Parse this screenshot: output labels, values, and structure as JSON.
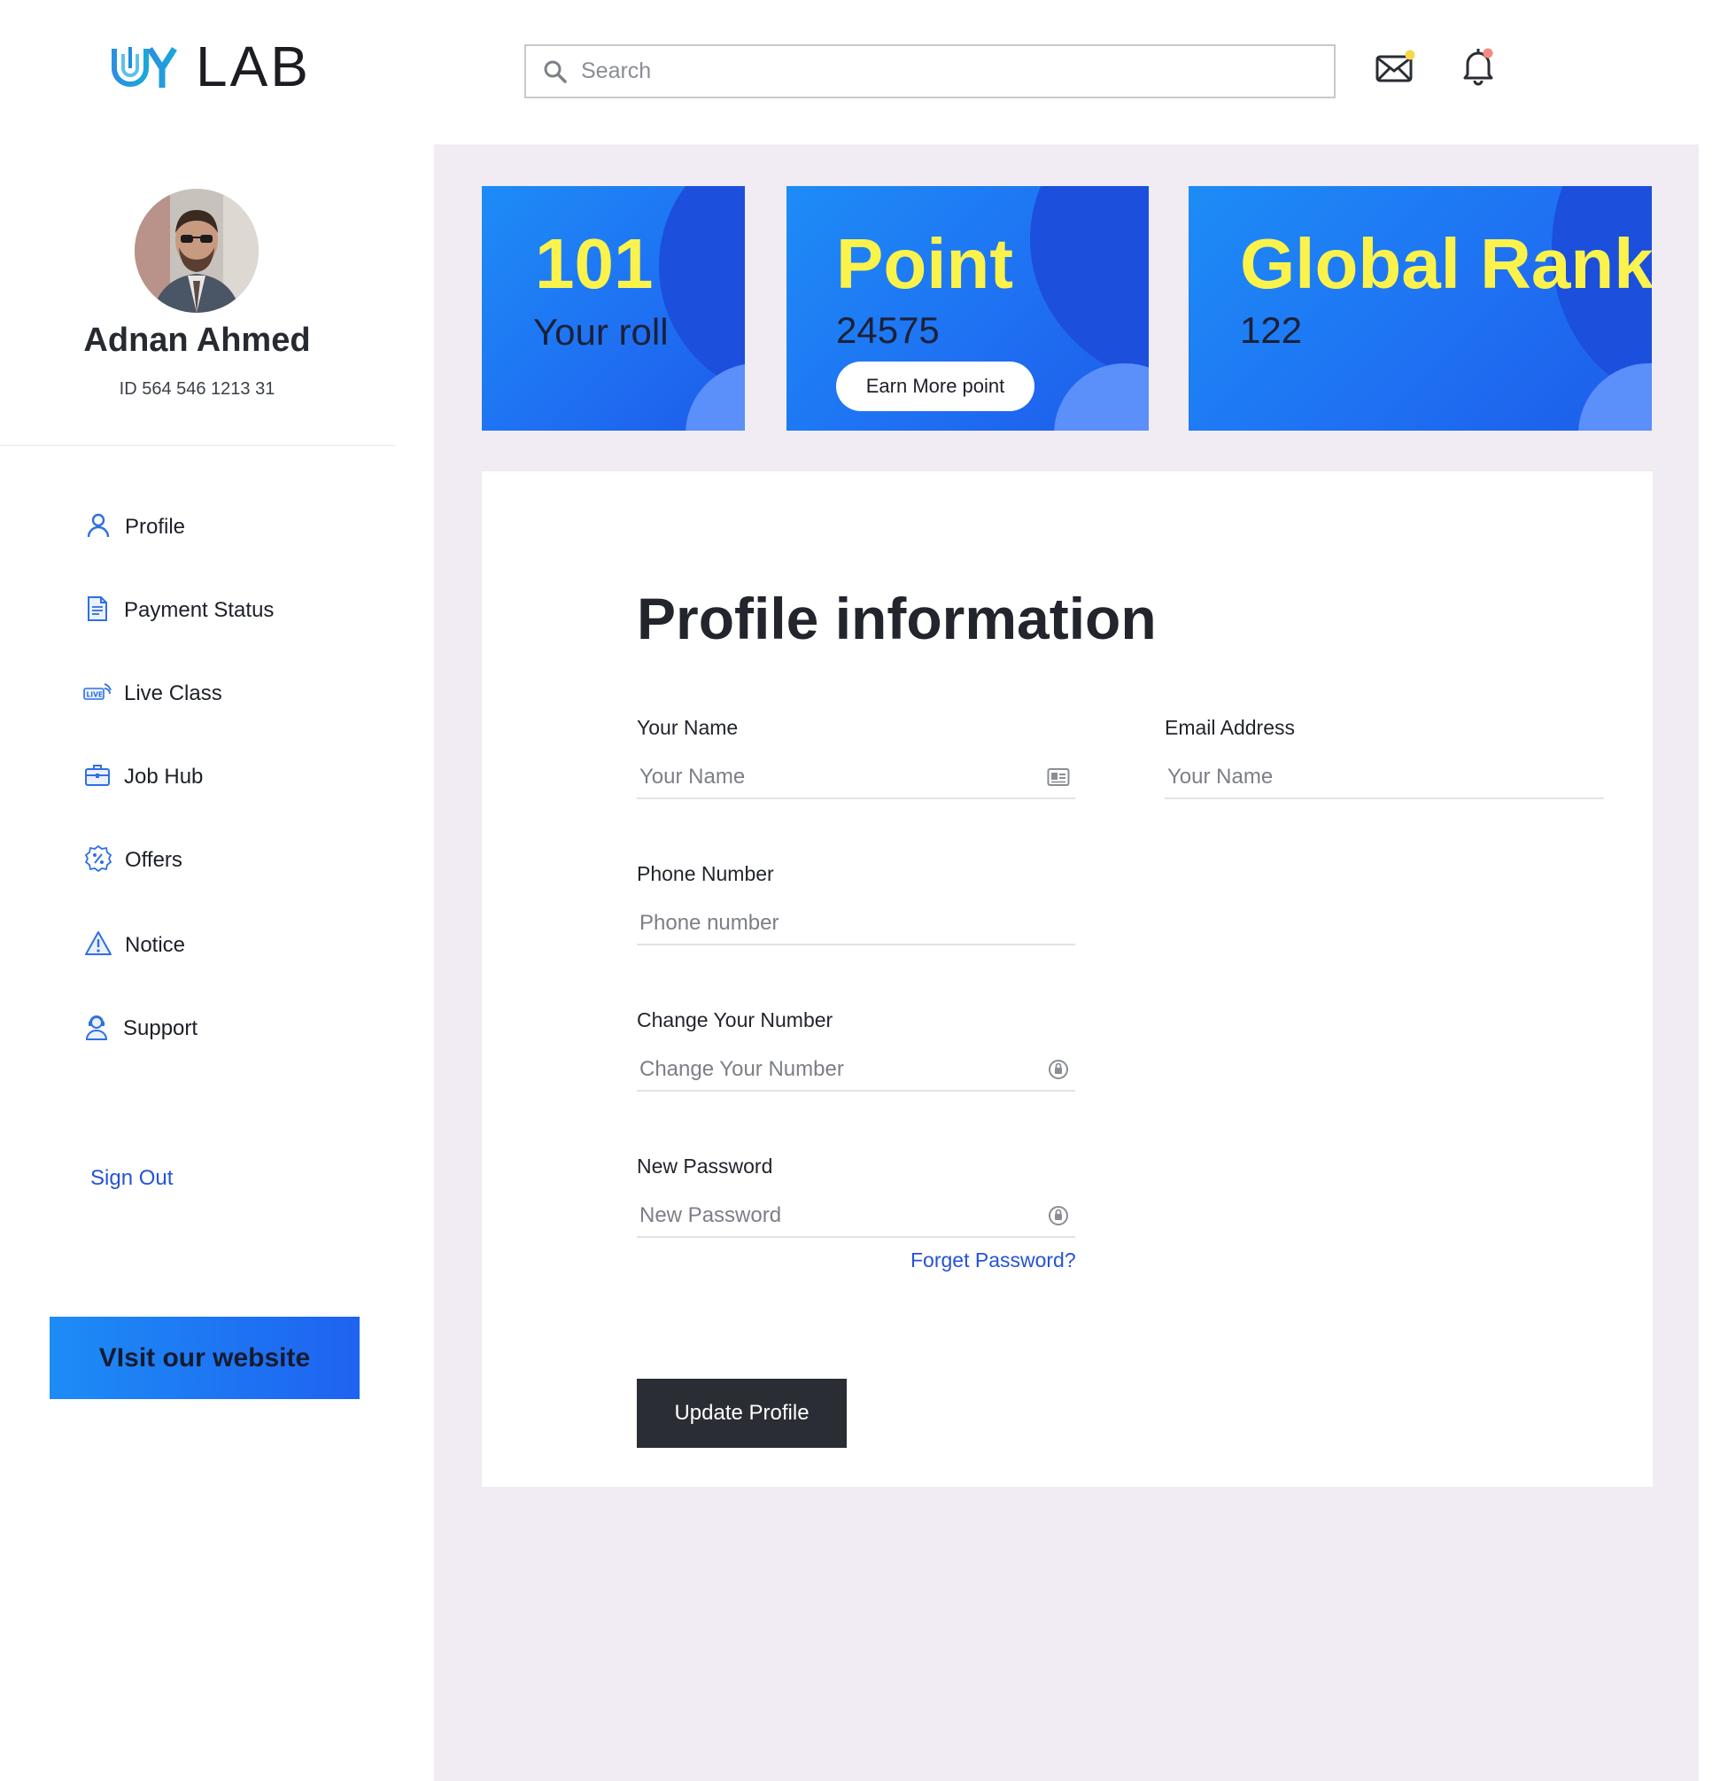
{
  "brand": {
    "logo_text": "LAB",
    "logo_mark": "UY"
  },
  "search": {
    "placeholder": "Search"
  },
  "header": {
    "mail_has_unread": true,
    "bell_has_unread": true
  },
  "user": {
    "name": "Adnan Ahmed",
    "id_label": "ID 564 546 1213 31"
  },
  "sidebar": {
    "items": [
      {
        "label": "Profile",
        "icon": "user-icon"
      },
      {
        "label": "Payment Status",
        "icon": "document-icon"
      },
      {
        "label": "Live Class",
        "icon": "live-icon"
      },
      {
        "label": "Job Hub",
        "icon": "briefcase-icon"
      },
      {
        "label": "Offers",
        "icon": "discount-badge-icon"
      },
      {
        "label": "Notice",
        "icon": "warning-icon"
      },
      {
        "label": "Support",
        "icon": "support-agent-icon"
      }
    ],
    "sign_out": "Sign Out",
    "visit_button": "VIsit our website"
  },
  "stats": {
    "roll": {
      "value": "101",
      "label": "Your roll"
    },
    "point": {
      "title": "Point",
      "value": "24575",
      "button": "Earn More point"
    },
    "rank": {
      "title": "Global Rank",
      "value": "122"
    }
  },
  "profile_form": {
    "title": "Profile information",
    "name": {
      "label": "Your Name",
      "placeholder": "Your Name"
    },
    "email": {
      "label": "Email Address",
      "placeholder": "Your Name"
    },
    "phone": {
      "label": "Phone Number",
      "placeholder": "Phone number"
    },
    "change_number": {
      "label": "Change Your Number",
      "placeholder": "Change Your Number"
    },
    "new_password": {
      "label": "New Password",
      "placeholder": "New Password"
    },
    "forget_password": "Forget Password?",
    "submit": "Update Profile"
  },
  "colors": {
    "accent_blue": "#1e6ff2",
    "stat_highlight": "#fbf34c",
    "link_blue": "#2552d8",
    "dark_button": "#2a2d33",
    "main_bg": "#f1ecf4"
  }
}
